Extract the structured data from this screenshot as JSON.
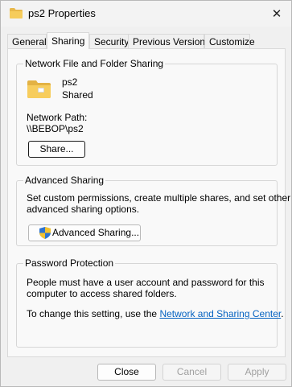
{
  "window": {
    "title": "ps2 Properties"
  },
  "tabs": [
    {
      "label": "General"
    },
    {
      "label": "Sharing"
    },
    {
      "label": "Security"
    },
    {
      "label": "Previous Versions"
    },
    {
      "label": "Customize"
    }
  ],
  "network_sharing": {
    "group_label": "Network File and Folder Sharing",
    "folder_name": "ps2",
    "folder_status": "Shared",
    "path_label": "Network Path:",
    "path_value": "\\\\BEBOP\\ps2",
    "share_button": "Share..."
  },
  "advanced_sharing": {
    "group_label": "Advanced Sharing",
    "description": "Set custom permissions, create multiple shares, and set other advanced sharing options.",
    "description_line1": "Set custom permissions, create multiple shares, and set other",
    "description_line2": "advanced sharing options.",
    "button": "Advanced Sharing..."
  },
  "password_protection": {
    "group_label": "Password Protection",
    "line1": "People must have a user account and password for this",
    "line2": "computer to access shared folders.",
    "change_prefix": "To change this setting, use the ",
    "link": "Network and Sharing Center",
    "change_suffix": "."
  },
  "footer": {
    "close": "Close",
    "cancel": "Cancel",
    "apply": "Apply"
  }
}
